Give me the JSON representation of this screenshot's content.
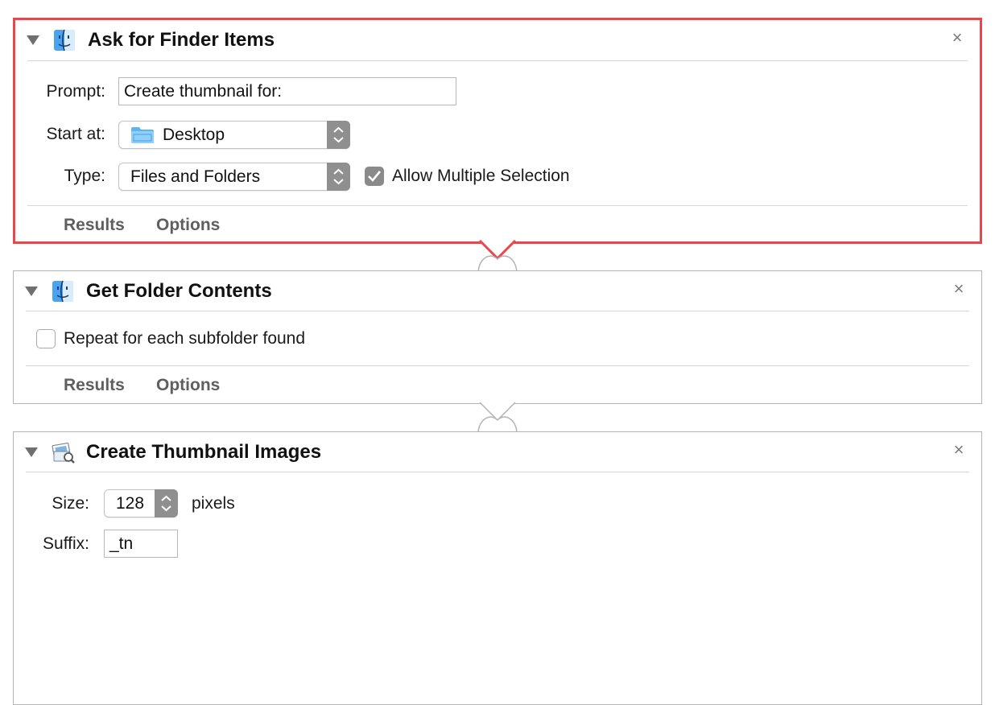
{
  "actions": [
    {
      "title": "Ask for Finder Items",
      "icon": "finder-icon",
      "selected": true,
      "prompt_label": "Prompt:",
      "prompt_value": "Create thumbnail for:",
      "start_label": "Start at:",
      "start_value": "Desktop",
      "type_label": "Type:",
      "type_value": "Files and Folders",
      "allow_multiple_label": "Allow Multiple Selection",
      "allow_multiple_checked": true,
      "results_label": "Results",
      "options_label": "Options"
    },
    {
      "title": "Get Folder Contents",
      "icon": "finder-icon",
      "repeat_label": "Repeat for each subfolder found",
      "repeat_checked": false,
      "results_label": "Results",
      "options_label": "Options"
    },
    {
      "title": "Create Thumbnail Images",
      "icon": "preview-icon",
      "size_label": "Size:",
      "size_value": "128",
      "size_unit": "pixels",
      "suffix_label": "Suffix:",
      "suffix_value": "_tn"
    }
  ],
  "close_glyph": "×",
  "colors": {
    "selection_border": "#e8484d",
    "normal_border": "#b4b4b4",
    "checkbox_checked": "#8a8a8a",
    "stepper": "#8f8f8f"
  }
}
